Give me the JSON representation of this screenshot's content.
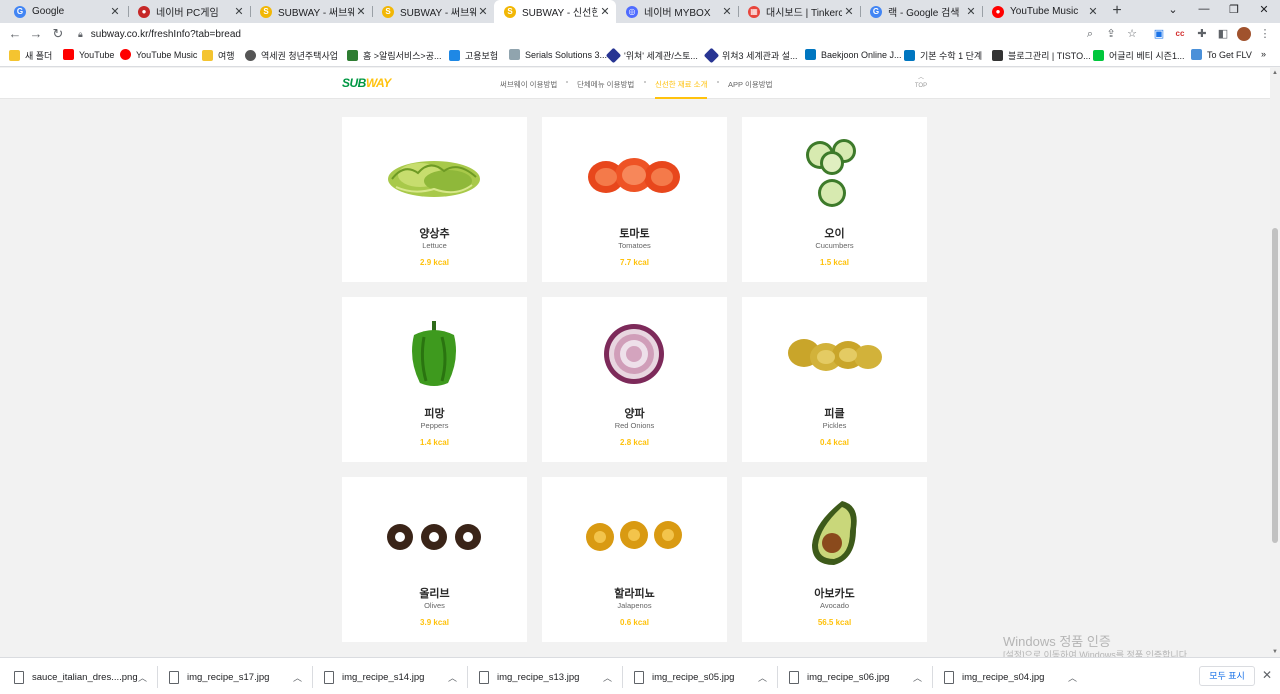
{
  "browser": {
    "tabs": [
      {
        "title": "Google",
        "favicon_color": "#4285f4",
        "favicon_glyph": "G"
      },
      {
        "title": "네이버 PC게임",
        "favicon_color": "#e53935",
        "favicon_glyph": "●"
      },
      {
        "title": "SUBWAY - 써브웨이 이",
        "favicon_color": "#f2b705",
        "favicon_glyph": "S"
      },
      {
        "title": "SUBWAY - 써브웨이 이",
        "favicon_color": "#f2b705",
        "favicon_glyph": "S"
      },
      {
        "title": "SUBWAY - 신선한 재료",
        "favicon_color": "#f2b705",
        "favicon_glyph": "S"
      },
      {
        "title": "네이버 MYBOX",
        "favicon_color": "#4f6bff",
        "favicon_glyph": "◎"
      },
      {
        "title": "대시보드 | Tinkercad",
        "favicon_color": "#e8453c",
        "favicon_glyph": "▦"
      },
      {
        "title": "랙 - Google 검색",
        "favicon_color": "#4285f4",
        "favicon_glyph": "G"
      },
      {
        "title": "YouTube Music",
        "favicon_color": "#ff0000",
        "favicon_glyph": "●"
      }
    ],
    "url": "subway.co.kr/freshInfo?tab=bread",
    "bookmarks": [
      {
        "label": "새 폴더",
        "color": "#f4c430"
      },
      {
        "label": "YouTube",
        "color": "#ff0000"
      },
      {
        "label": "YouTube Music",
        "color": "#ff0000"
      },
      {
        "label": "여행",
        "color": "#f4c430"
      },
      {
        "label": "역세권 청년주택사업",
        "color": "#555555"
      },
      {
        "label": "홈 >알림서비스>공...",
        "color": "#2e7d32"
      },
      {
        "label": "고용보험",
        "color": "#1e88e5"
      },
      {
        "label": "Serials Solutions 3...",
        "color": "#90a4ae"
      },
      {
        "label": "'위쳐' 세계관/스토...",
        "color": "#283593"
      },
      {
        "label": "위쳐3 세계관과 설...",
        "color": "#283593"
      },
      {
        "label": "Baekjoon Online J...",
        "color": "#0076c0"
      },
      {
        "label": "기본 수학 1 단계",
        "color": "#0076c0"
      },
      {
        "label": "블로그관리 | TISTO...",
        "color": "#333333"
      },
      {
        "label": "어글리 베티 시즌1...",
        "color": "#00c73c"
      },
      {
        "label": "To Get FLV",
        "color": "#4a90d9"
      }
    ]
  },
  "site": {
    "logo_main": "SUB",
    "logo_accent": "WAY",
    "nav": [
      "써브웨이 이용방법",
      "단체메뉴 이용방법",
      "신선한 재료 소개",
      "APP 이용방법"
    ],
    "top_label": "TOP",
    "accent_color": "#ffc20d",
    "ingredients": [
      {
        "ko": "양상추",
        "en": "Lettuce",
        "kcal": "2.9 kcal",
        "icon": "lettuce-icon"
      },
      {
        "ko": "토마토",
        "en": "Tomatoes",
        "kcal": "7.7 kcal",
        "icon": "tomato-icon"
      },
      {
        "ko": "오이",
        "en": "Cucumbers",
        "kcal": "1.5 kcal",
        "icon": "cucumber-icon"
      },
      {
        "ko": "피망",
        "en": "Peppers",
        "kcal": "1.4 kcal",
        "icon": "pepper-icon"
      },
      {
        "ko": "양파",
        "en": "Red Onions",
        "kcal": "2.8 kcal",
        "icon": "onion-icon"
      },
      {
        "ko": "피클",
        "en": "Pickles",
        "kcal": "0.4 kcal",
        "icon": "pickle-icon"
      },
      {
        "ko": "올리브",
        "en": "Olives",
        "kcal": "3.9 kcal",
        "icon": "olive-icon"
      },
      {
        "ko": "할라피뇨",
        "en": "Jalapenos",
        "kcal": "0.6 kcal",
        "icon": "jalapeno-icon"
      },
      {
        "ko": "아보카도",
        "en": "Avocado",
        "kcal": "56.5 kcal",
        "icon": "avocado-icon"
      }
    ]
  },
  "os": {
    "watermark_title": "Windows 정품 인증",
    "watermark_sub": "[설정]으로 이동하여 Windows를 정품 인증합니다."
  },
  "downloads": {
    "files": [
      "sauce_italian_dres....png",
      "img_recipe_s17.jpg",
      "img_recipe_s14.jpg",
      "img_recipe_s13.jpg",
      "img_recipe_s05.jpg",
      "img_recipe_s06.jpg",
      "img_recipe_s04.jpg"
    ],
    "show_all": "모두 표시"
  }
}
